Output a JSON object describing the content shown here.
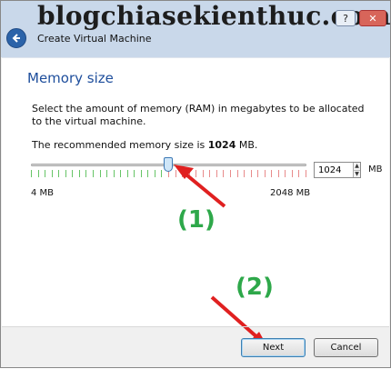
{
  "watermark": "blogchiasekienthuc.com",
  "window": {
    "title": "Create Virtual Machine",
    "help_label": "?",
    "close_label": "✕"
  },
  "page": {
    "heading": "Memory size",
    "description": "Select the amount of memory (RAM) in megabytes to be allocated to the virtual machine.",
    "recommendation_prefix": "The recommended memory size is ",
    "recommendation_value": "1024",
    "recommendation_suffix": " MB."
  },
  "memory": {
    "slider_min_label": "4 MB",
    "slider_max_label": "2048 MB",
    "slider_min": 4,
    "slider_max": 2048,
    "value": 1024,
    "input_value": "1024",
    "unit": "MB"
  },
  "annotations": {
    "step1": "(1)",
    "step2": "(2)",
    "color": "#2ea84a",
    "arrow_color": "#e02020"
  },
  "buttons": {
    "next": "Next",
    "cancel": "Cancel"
  },
  "colors": {
    "heading": "#1e4e9c",
    "tick_safe": "#66c466",
    "tick_warn": "#e88a8a"
  }
}
